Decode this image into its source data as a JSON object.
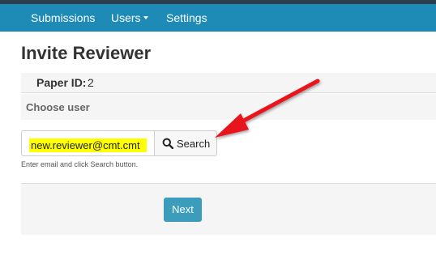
{
  "nav": {
    "items": [
      {
        "label": "Submissions"
      },
      {
        "label": "Users",
        "has_dropdown": true
      },
      {
        "label": "Settings"
      }
    ],
    "background": "#1e8bb7"
  },
  "page": {
    "title": "Invite Reviewer"
  },
  "paper": {
    "label": "Paper ID:",
    "value": "2"
  },
  "choose_user": {
    "label": "Choose user"
  },
  "search": {
    "value": "new.reviewer@cmt.cmt",
    "button_label": "Search",
    "icon": "search-icon",
    "help": "Enter email and click Search button."
  },
  "actions": {
    "next_label": "Next"
  },
  "colors": {
    "highlight": "#ffff00",
    "arrow": "#e8131b",
    "primary_button": "#3b9dbb"
  }
}
